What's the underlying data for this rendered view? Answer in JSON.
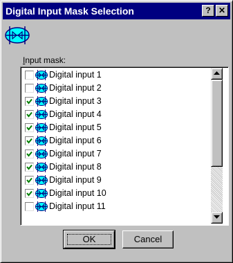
{
  "window": {
    "title": "Digital Input Mask Selection",
    "help_label": "?",
    "close_label": "✕"
  },
  "mask": {
    "label_prefix": "I",
    "label_rest": "nput mask:"
  },
  "items": [
    {
      "label": "Digital input 1",
      "checked": false
    },
    {
      "label": "Digital input 2",
      "checked": false
    },
    {
      "label": "Digital input 3",
      "checked": true
    },
    {
      "label": "Digital input 4",
      "checked": true
    },
    {
      "label": "Digital input 5",
      "checked": true
    },
    {
      "label": "Digital input 6",
      "checked": true
    },
    {
      "label": "Digital input 7",
      "checked": true
    },
    {
      "label": "Digital input 8",
      "checked": true
    },
    {
      "label": "Digital input 9",
      "checked": true
    },
    {
      "label": "Digital input 10",
      "checked": true
    },
    {
      "label": "Digital input 11",
      "checked": false
    }
  ],
  "buttons": {
    "ok_label": "OK",
    "cancel_label": "Cancel"
  },
  "icons": {
    "header": "digital-input-icon",
    "row": "digital-input-icon",
    "help": "help-icon",
    "close": "close-icon",
    "scroll_up": "arrow-up-icon",
    "scroll_down": "arrow-down-icon"
  },
  "colors": {
    "titlebar": "#000080",
    "icon_fill": "#00ffff",
    "check": "#008000"
  }
}
